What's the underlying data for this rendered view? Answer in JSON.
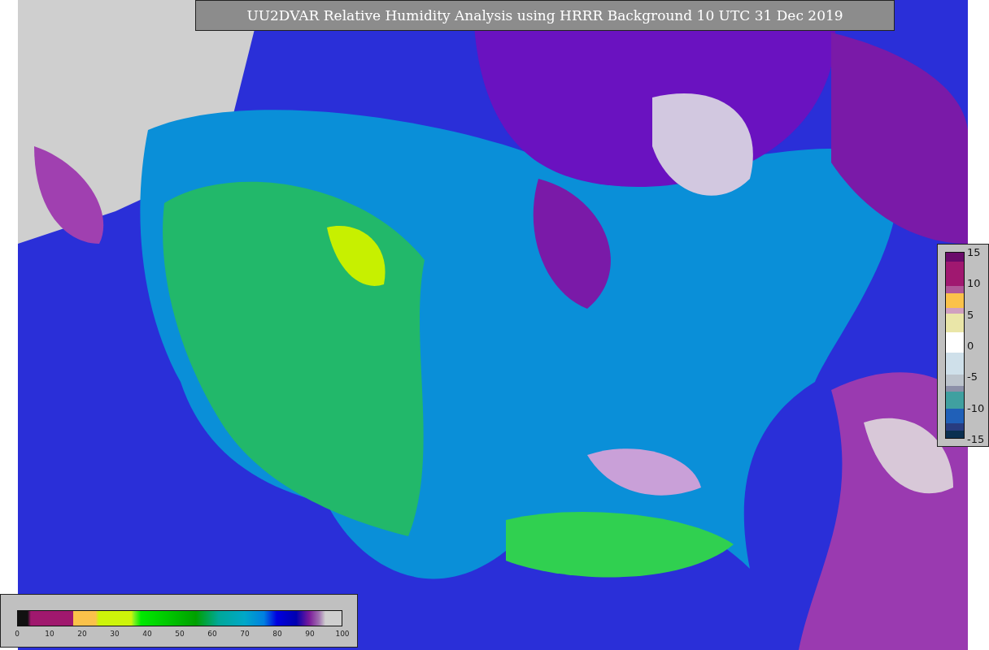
{
  "title": "UU2DVAR Relative Humidity Analysis using HRRR Background 10 UTC 31 Dec 2019",
  "humidity_colorbar": {
    "tick_labels": [
      "0",
      "10",
      "20",
      "30",
      "40",
      "50",
      "60",
      "70",
      "80",
      "90",
      "100"
    ]
  },
  "difference_colorbar": {
    "tick_labels": [
      "15",
      "10",
      "5",
      "0",
      "-5",
      "-10",
      "-15"
    ]
  }
}
